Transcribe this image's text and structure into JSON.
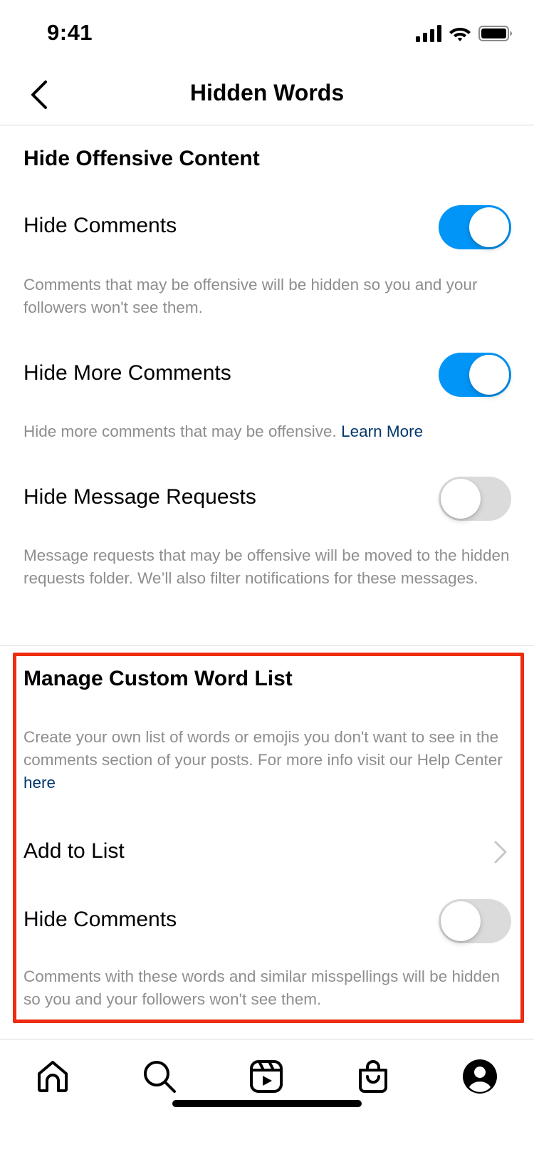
{
  "status_bar": {
    "time": "9:41"
  },
  "nav": {
    "title": "Hidden Words",
    "back_icon": "chevron-left-icon"
  },
  "offensive": {
    "header": "Hide Offensive Content",
    "hide_comments": {
      "label": "Hide Comments",
      "enabled": true,
      "description": "Comments that may be offensive will be hidden so you and your followers won't see them."
    },
    "hide_more_comments": {
      "label": "Hide More Comments",
      "enabled": true,
      "description": "Hide more comments that may be offensive.",
      "link": "Learn More"
    },
    "hide_message_requests": {
      "label": "Hide Message Requests",
      "enabled": false,
      "description": "Message requests that may be offensive will be moved to the hidden requests folder. We’ll also filter notifications for these messages."
    }
  },
  "custom": {
    "header": "Manage Custom Word List",
    "description": "Create your own list of words or emojis you don't want to see in the comments section of your posts. For more info visit our Help Center",
    "link": "here",
    "add_to_list": {
      "label": "Add to List"
    },
    "hide_comments": {
      "label": "Hide Comments",
      "enabled": false,
      "description": "Comments with these words and similar misspellings will be hidden so you and your followers won't see them."
    }
  },
  "colors": {
    "toggle_on": "#0095f6",
    "toggle_off": "#dbdbdb",
    "link": "#00376b",
    "muted_text": "#8e8e8e",
    "highlight": "#ee2c10"
  },
  "tab_bar": {
    "tabs": [
      "home-icon",
      "search-icon",
      "reels-icon",
      "shop-icon",
      "profile-icon"
    ]
  }
}
